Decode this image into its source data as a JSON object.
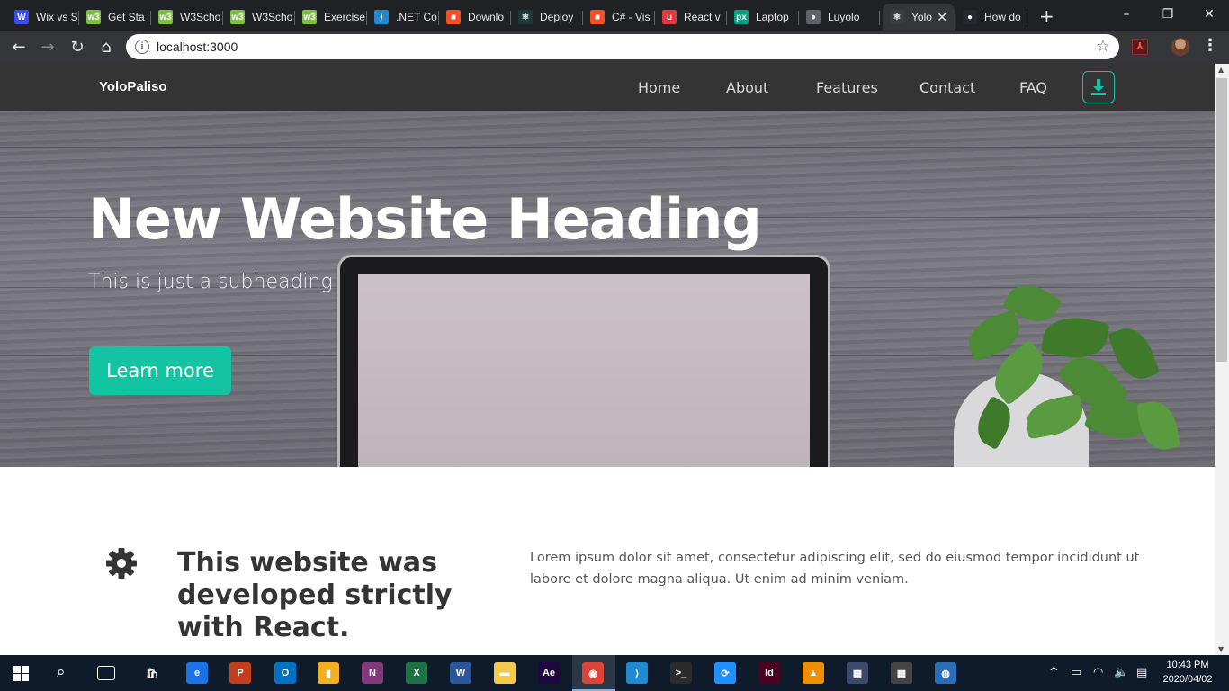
{
  "browser": {
    "tabs": [
      {
        "title": "Wix vs S",
        "favicon": "wix-icon",
        "color": "#3a4cf0",
        "glyph": "W"
      },
      {
        "title": "Get Sta",
        "favicon": "w3schools-icon",
        "color": "#7cc242",
        "glyph": "w3"
      },
      {
        "title": "W3Scho",
        "favicon": "w3schools-icon",
        "color": "#7cc242",
        "glyph": "w3"
      },
      {
        "title": "W3Scho",
        "favicon": "w3schools-icon",
        "color": "#7cc242",
        "glyph": "w3"
      },
      {
        "title": "Exercise",
        "favicon": "w3schools-icon",
        "color": "#7cc242",
        "glyph": "w3"
      },
      {
        "title": ".NET Co",
        "favicon": "vscode-icon",
        "color": "#1f8ad2",
        "glyph": "⟩"
      },
      {
        "title": "Downlo",
        "favicon": "microsoft-icon",
        "color": "#f25022",
        "glyph": "■"
      },
      {
        "title": "Deploy",
        "favicon": "react-icon",
        "color": "#1d3a3a",
        "glyph": "⚛"
      },
      {
        "title": "C# - Vis",
        "favicon": "microsoft-icon",
        "color": "#f25022",
        "glyph": "■"
      },
      {
        "title": "React v",
        "favicon": "react-blog-icon",
        "color": "#e0393e",
        "glyph": "u"
      },
      {
        "title": "Laptop",
        "favicon": "pexels-icon",
        "color": "#05a081",
        "glyph": "px"
      },
      {
        "title": "Luyolo",
        "favicon": "user-icon",
        "color": "#5f6368",
        "glyph": "●"
      },
      {
        "title": "Yolo",
        "favicon": "react-icon",
        "color": "#3a3c40",
        "glyph": "⚛"
      },
      {
        "title": "How do",
        "favicon": "github-icon",
        "color": "#24292e",
        "glyph": "●"
      }
    ],
    "new_tab_label": "+",
    "url": "localhost:3000",
    "window_controls": [
      "–",
      "❐",
      "✕"
    ]
  },
  "site": {
    "brand": "YoloPaliso",
    "nav": [
      "Home",
      "About",
      "Features",
      "Contact",
      "FAQ"
    ],
    "hero": {
      "title": "New Website Heading",
      "subtitle": "This is just a subheading",
      "button": "Learn more"
    },
    "feature": {
      "icon": "gear-icon",
      "title": "This website was developed strictly with React.",
      "text": "Lorem ipsum dolor sit amet, consectetur adipiscing elit, sed do eiusmod tempor incididunt ut labore et dolore magna aliqua. Ut enim ad minim veniam."
    },
    "accent_color": "#13c4a3"
  },
  "taskbar": {
    "apps": [
      {
        "name": "taskview-icon",
        "label": "",
        "color": "#0f1b2b"
      },
      {
        "name": "store-icon",
        "label": "🛍",
        "color": "#0f1b2b"
      },
      {
        "name": "edge-icon",
        "label": "e",
        "color": "#1a73e8"
      },
      {
        "name": "powerpoint-icon",
        "label": "P",
        "color": "#c43e1c"
      },
      {
        "name": "outlook-icon",
        "label": "O",
        "color": "#0072c6"
      },
      {
        "name": "files-icon",
        "label": "▮",
        "color": "#f2b01e"
      },
      {
        "name": "onenote-icon",
        "label": "N",
        "color": "#80397b"
      },
      {
        "name": "excel-icon",
        "label": "X",
        "color": "#1e7145"
      },
      {
        "name": "word-icon",
        "label": "W",
        "color": "#2b579a"
      },
      {
        "name": "file-explorer-icon",
        "label": "▬",
        "color": "#f2c94c"
      },
      {
        "name": "after-effects-icon",
        "label": "Ae",
        "color": "#1f0740"
      },
      {
        "name": "chrome-icon",
        "label": "◉",
        "color": "#db4437"
      },
      {
        "name": "vscode-icon",
        "label": "⟩",
        "color": "#1f8ad2"
      },
      {
        "name": "terminal-icon",
        "label": ">_",
        "color": "#2b2b2b"
      },
      {
        "name": "sync-icon",
        "label": "⟳",
        "color": "#1e90ff"
      },
      {
        "name": "indesign-icon",
        "label": "Id",
        "color": "#49021f"
      },
      {
        "name": "vlc-icon",
        "label": "▲",
        "color": "#f18e00"
      },
      {
        "name": "game-icon",
        "label": "▦",
        "color": "#3b4a6b"
      },
      {
        "name": "photo-app-icon",
        "label": "▦",
        "color": "#444"
      },
      {
        "name": "network-app-icon",
        "label": "◍",
        "color": "#2d6db5"
      }
    ],
    "time": "10:43 PM",
    "date": "2020/04/02"
  }
}
